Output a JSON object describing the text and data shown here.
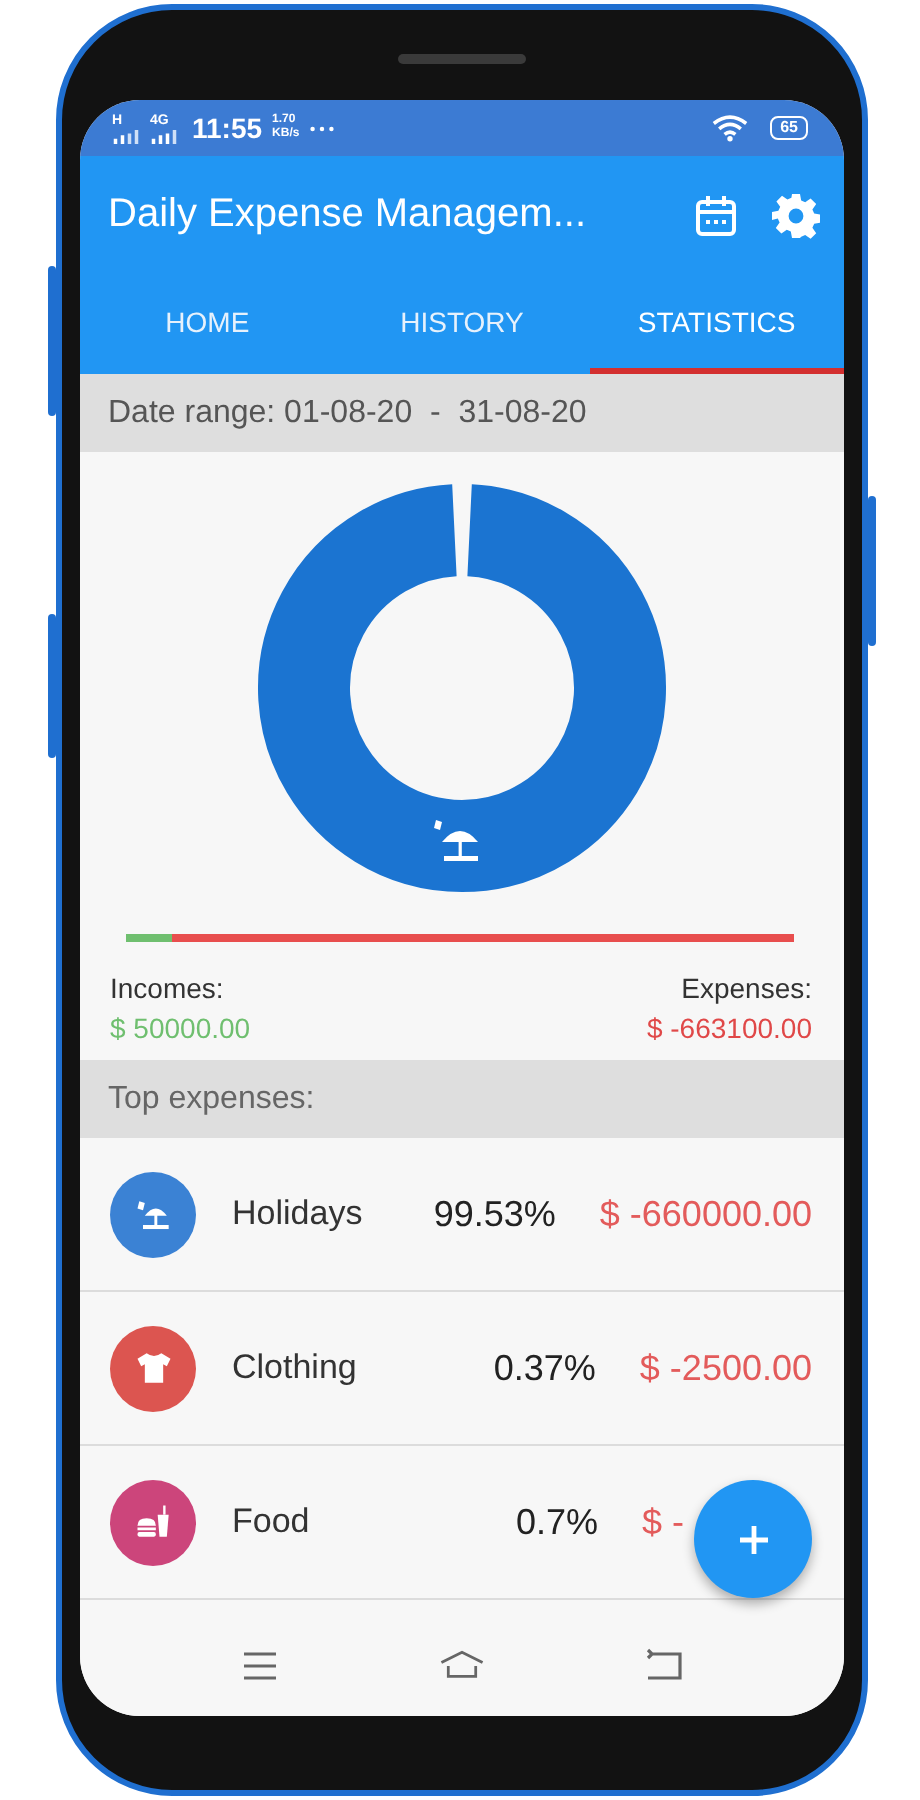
{
  "status_bar": {
    "network_1": "H",
    "network_2": "4G",
    "time": "11:55",
    "speed_value": "1.70",
    "speed_unit": "KB/s",
    "battery": "65"
  },
  "app_bar": {
    "title": "Daily Expense Managem..."
  },
  "tabs": [
    {
      "label": "HOME",
      "selected": false
    },
    {
      "label": "HISTORY",
      "selected": false
    },
    {
      "label": "STATISTICS",
      "selected": true
    }
  ],
  "date_range": "Date range: 01-08-20  -  31-08-20",
  "income_bar": {
    "level": 0.07
  },
  "incomes": {
    "label": "Incomes:",
    "amount": "$ 50000.00"
  },
  "expenses": {
    "label": "Expenses:",
    "amount": "$ -663100.00"
  },
  "top_expenses": {
    "title": "Top expenses:",
    "rows": [
      {
        "kind": "holidays",
        "name": "Holidays",
        "percent": "99.53%",
        "amount": "$ -660000.00",
        "color": "#3b82d4"
      },
      {
        "kind": "clothing",
        "name": "Clothing",
        "percent": "0.37%",
        "amount": "$ -2500.00",
        "color": "#dc5550"
      },
      {
        "kind": "food",
        "name": "Food",
        "percent": "0.7%",
        "amount": "$ -",
        "color": "#cc457b"
      }
    ]
  }
}
